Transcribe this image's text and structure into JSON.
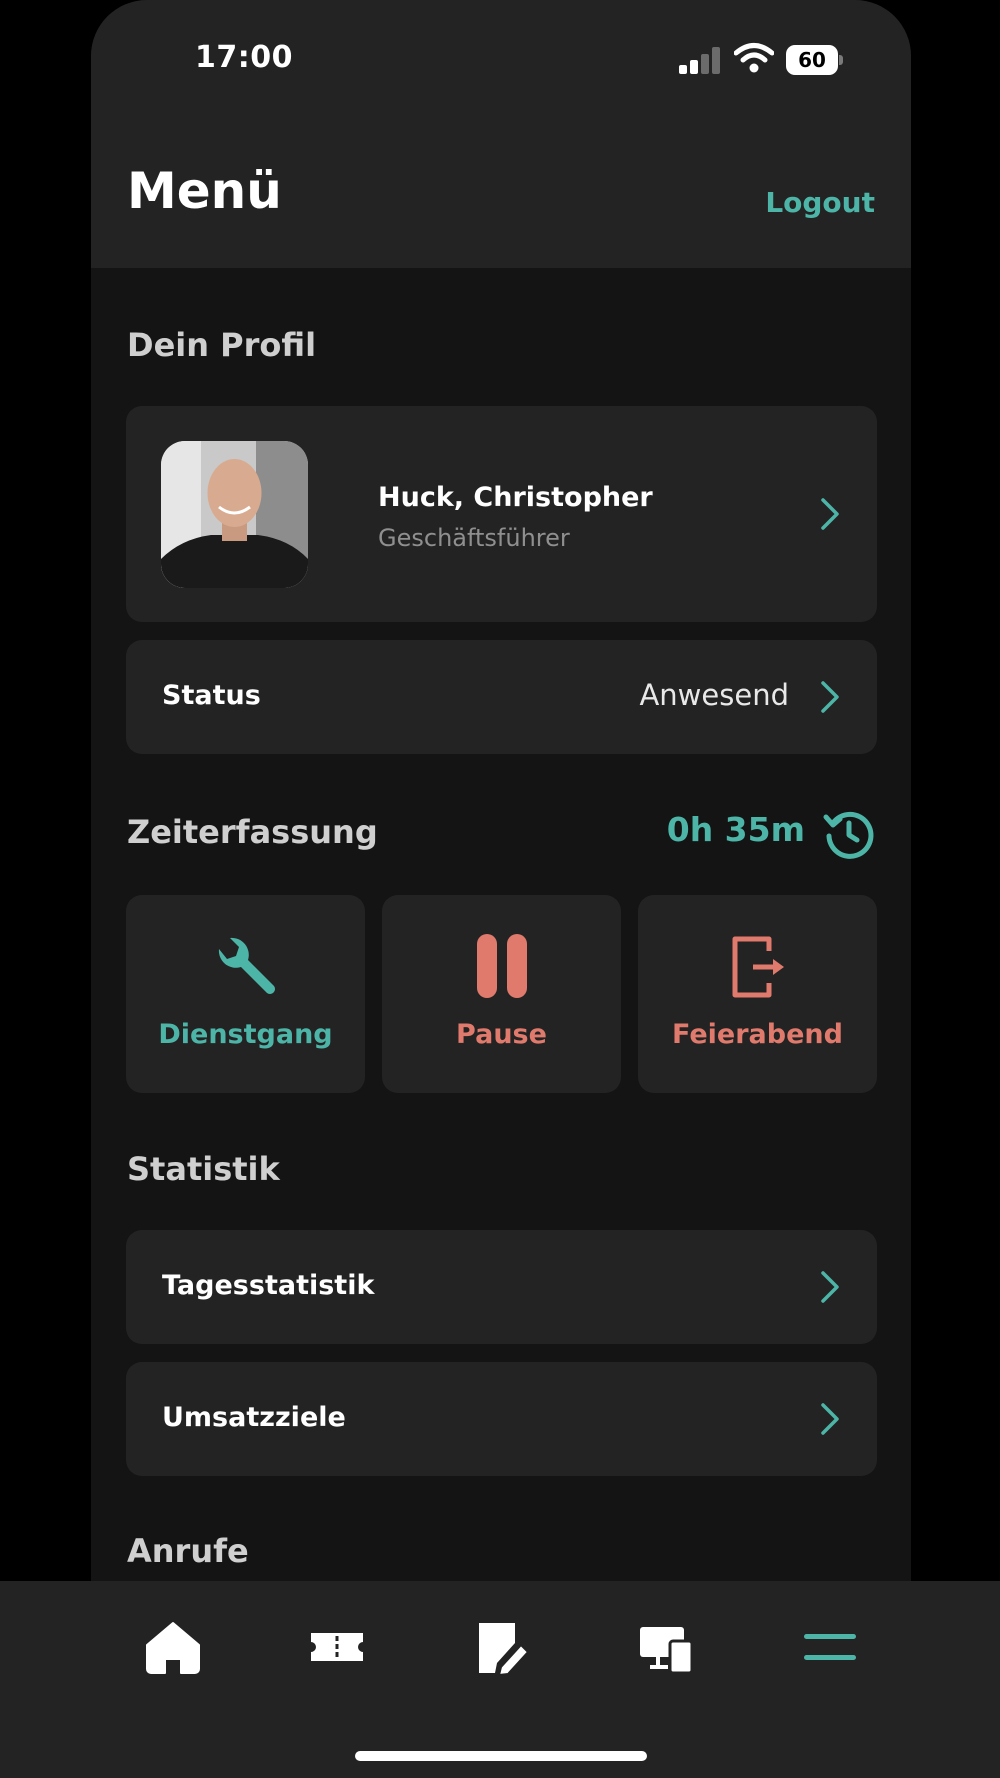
{
  "status_bar": {
    "time": "17:00",
    "battery": "60"
  },
  "header": {
    "title": "Menü",
    "logout_label": "Logout"
  },
  "profile_section": {
    "heading": "Dein Profil",
    "name": "Huck, Christopher",
    "role": "Geschäftsführer"
  },
  "status_row": {
    "label": "Status",
    "value": "Anwesend"
  },
  "time_tracking": {
    "heading": "Zeiterfassung",
    "elapsed": "0h 35m",
    "actions": [
      {
        "label": "Dienstgang",
        "icon": "wrench-icon",
        "color": "#4db5a8"
      },
      {
        "label": "Pause",
        "icon": "pause-icon",
        "color": "#e07a6c"
      },
      {
        "label": "Feierabend",
        "icon": "logout-door-icon",
        "color": "#e07a6c"
      }
    ]
  },
  "statistics": {
    "heading": "Statistik",
    "items": [
      {
        "label": "Tagesstatistik"
      },
      {
        "label": "Umsatzziele"
      }
    ]
  },
  "calls": {
    "heading": "Anrufe"
  },
  "bottom_nav": {
    "items": [
      {
        "icon": "home-icon"
      },
      {
        "icon": "ticket-icon"
      },
      {
        "icon": "edit-note-icon"
      },
      {
        "icon": "devices-icon"
      },
      {
        "icon": "menu-icon",
        "active": true
      }
    ]
  },
  "colors": {
    "accent": "#4db5a8",
    "warning": "#e07a6c",
    "card": "#232323",
    "background": "#141414"
  }
}
